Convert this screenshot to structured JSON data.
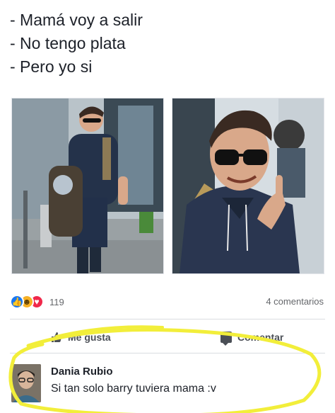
{
  "post": {
    "lines": [
      "- Mamá voy a salir",
      "- No tengo plata",
      "- Pero yo si"
    ]
  },
  "reactions": {
    "count": "119",
    "comments": "4 comentarios"
  },
  "actions": {
    "like_label": "Me gusta",
    "comment_label": "Comentar"
  },
  "comment": {
    "author": "Dania Rubio",
    "text": "Si tan solo barry tuviera mama :v"
  },
  "colors": {
    "highlight": "#f2ee3a",
    "like_blue": "#1877f2",
    "text_muted": "#65676b"
  }
}
